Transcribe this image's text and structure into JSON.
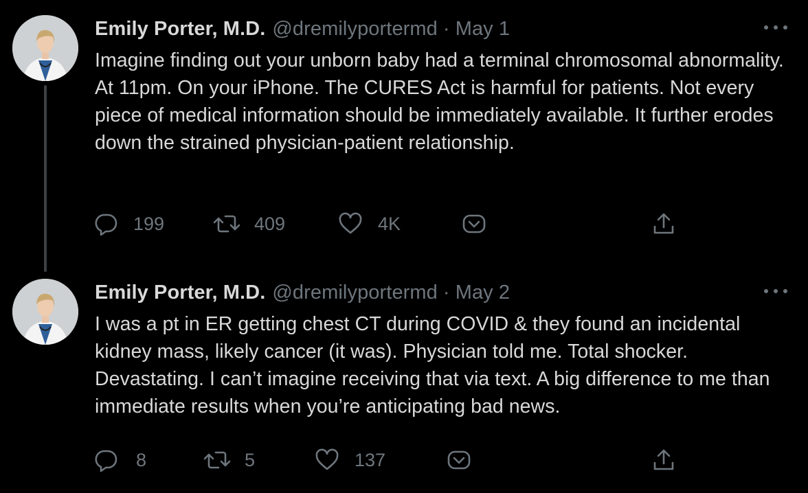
{
  "tweets": [
    {
      "author_name": "Emily Porter, M.D.",
      "handle": "@dremilyportermd",
      "separator": "·",
      "date": "May 1",
      "text": "Imagine finding out your unborn baby had a terminal chromosomal abnormality. At 11pm. On your iPhone. The CURES Act is harmful for patients. Not every piece of medical information should be immediately available. It further erodes down the strained physician-patient relationship.",
      "replies": "199",
      "retweets": "409",
      "likes": "4K"
    },
    {
      "author_name": "Emily Porter, M.D.",
      "handle": "@dremilyportermd",
      "separator": "·",
      "date": "May 2",
      "text": "I was a pt in ER getting chest CT during COVID & they found an incidental kidney mass, likely cancer (it was). Physician told me. Total shocker. Devastating. I can’t imagine receiving that via text. A big difference to me than immediate results when you’re anticipating bad news.",
      "replies": "8",
      "retweets": "5",
      "likes": "137"
    }
  ],
  "icons": {
    "reply": "speech-bubble-icon",
    "retweet": "retweet-arrows-icon",
    "like": "heart-icon",
    "share_menu": "share-chevron-icon",
    "upload": "upload-arrow-icon",
    "more": "ellipsis-icon"
  },
  "colors": {
    "background": "#000000",
    "text": "#d9d9d9",
    "muted": "#6e767d",
    "thread_line": "#3d4144"
  }
}
